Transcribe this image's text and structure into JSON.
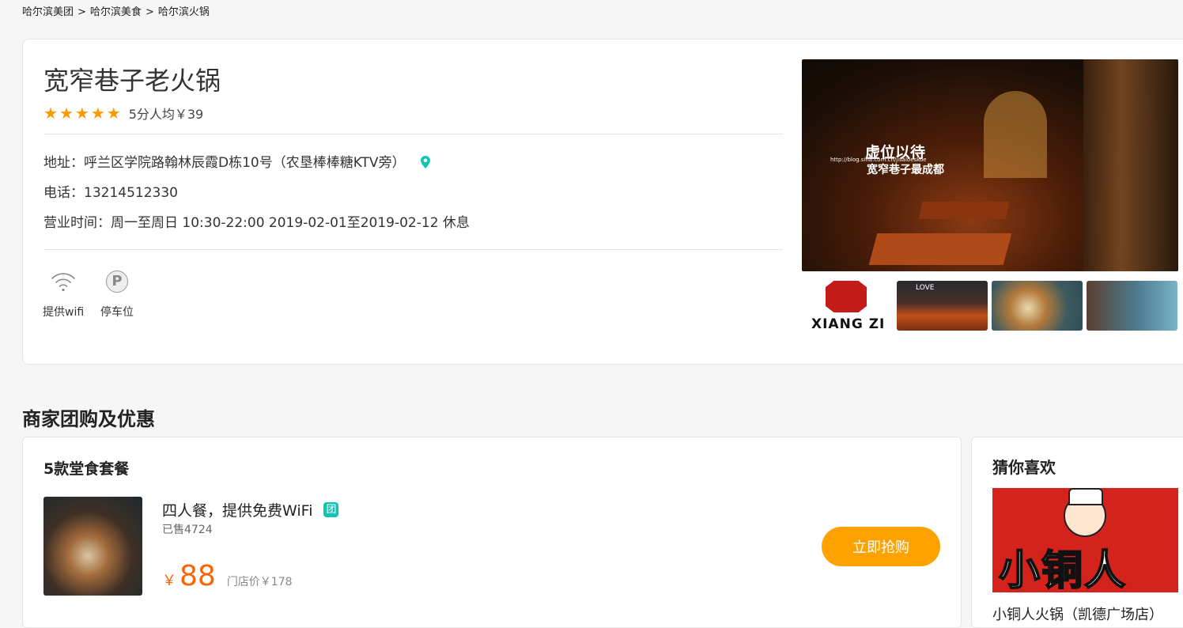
{
  "breadcrumb": [
    "哈尔滨美团",
    "哈尔滨美食",
    "哈尔滨火锅"
  ],
  "breadcrumb_sep": ">",
  "shop": {
    "name": "宽窄巷子老火锅",
    "stars": 5,
    "rating_text": "5分人均￥39",
    "address": "地址：呼兰区学院路翰林辰霞D栋10号（农垦棒棒糖KTV旁）",
    "phone": "电话：13214512330",
    "hours": "营业时间：周一至周日 10:30-22:00 2019-02-01至2019-02-12 休息",
    "facilities": [
      {
        "label": "提供wifi",
        "icon": "wifi-icon"
      },
      {
        "label": "停车位",
        "icon": "parking-icon"
      }
    ],
    "photo_caption": "虚位以待",
    "photo_url": "http://blog.sina.com.cn/jisaloeskoe",
    "photo_subcaption": "宽窄巷子最成都",
    "thumb_logo_text": "XIANG ZI",
    "thumb_love_text": "LOVE"
  },
  "deals": {
    "section_title": "商家团购及优惠",
    "group_title": "5款堂食套餐",
    "item": {
      "name": "四人餐，提供免费WiFi",
      "badge": "团",
      "sold": "已售4724",
      "currency": "￥",
      "price": "88",
      "original_price": "门店价￥178",
      "buy_label": "立即抢购"
    }
  },
  "recommend": {
    "title": "猜你喜欢",
    "image_text": "小铜人",
    "item_name": "小铜人火锅（凯德广场店）"
  },
  "colors": {
    "star": "#ff9900",
    "price": "#ff6200",
    "buy_button": "#ffa200",
    "tuan_badge": "#13c3b3",
    "location_pin": "#13c3b3"
  }
}
